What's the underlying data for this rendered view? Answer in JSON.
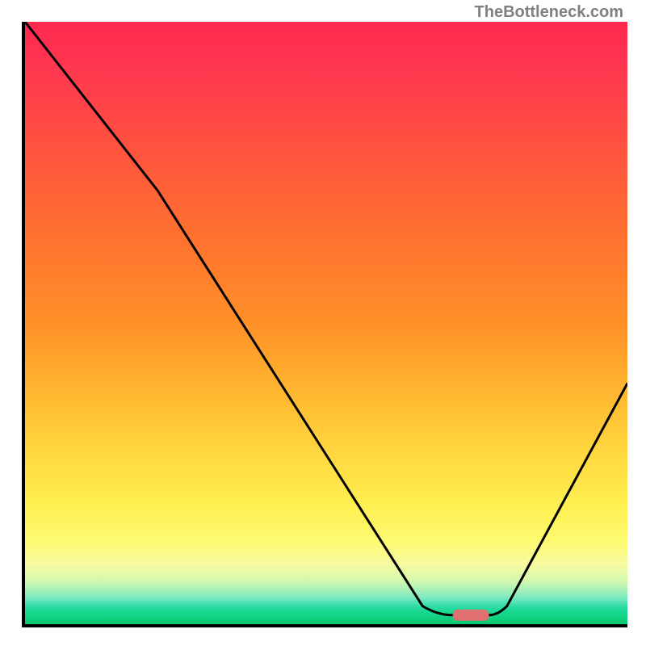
{
  "watermark": "TheBottleneck.com",
  "chart_data": {
    "type": "line",
    "title": "",
    "xlabel": "",
    "ylabel": "",
    "xlim": [
      0,
      100
    ],
    "ylim": [
      0,
      100
    ],
    "curve": [
      {
        "x": 0,
        "y": 100
      },
      {
        "x": 22,
        "y": 72
      },
      {
        "x": 66,
        "y": 3
      },
      {
        "x": 71,
        "y": 1.5
      },
      {
        "x": 77,
        "y": 1.5
      },
      {
        "x": 80,
        "y": 3
      },
      {
        "x": 100,
        "y": 40
      }
    ],
    "marker": {
      "x_start": 71,
      "x_end": 77,
      "y": 1.5,
      "color": "#e07070"
    },
    "gradient_stops": [
      {
        "pos": 0.0,
        "color": "#ff2850"
      },
      {
        "pos": 0.5,
        "color": "#ff9028"
      },
      {
        "pos": 0.82,
        "color": "#ffef50"
      },
      {
        "pos": 1.0,
        "color": "#08c870"
      }
    ]
  }
}
